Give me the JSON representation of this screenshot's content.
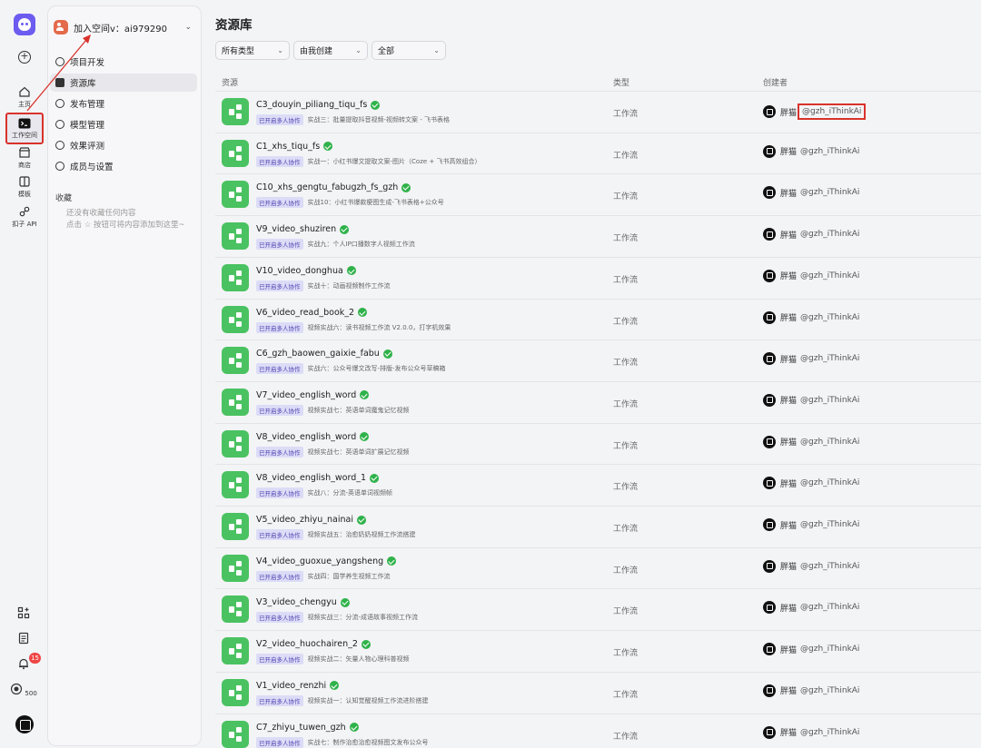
{
  "rail": {
    "items": [
      {
        "label": "主页",
        "icon": "home-icon"
      },
      {
        "label": "工作空间",
        "icon": "terminal-icon"
      },
      {
        "label": "商店",
        "icon": "store-icon"
      },
      {
        "label": "模板",
        "icon": "template-icon"
      },
      {
        "label": "扣子 API",
        "icon": "api-icon"
      }
    ],
    "notification_count": "15",
    "points": "500"
  },
  "sidebar": {
    "space_name": "加入空间v：ai979290",
    "nav": [
      {
        "label": "项目开发",
        "icon": "smile-icon"
      },
      {
        "label": "资源库",
        "icon": "library-icon"
      },
      {
        "label": "发布管理",
        "icon": "rocket-icon"
      },
      {
        "label": "模型管理",
        "icon": "cube-icon"
      },
      {
        "label": "效果评测",
        "icon": "gauge-icon"
      },
      {
        "label": "成员与设置",
        "icon": "users-icon"
      }
    ],
    "favorites_title": "收藏",
    "favorites_empty_1": "还没有收藏任何内容",
    "favorites_empty_2": "点击 ☆ 按钮可将内容添加到这里~"
  },
  "main": {
    "title": "资源库",
    "filters": [
      "所有类型",
      "由我创建",
      "全部"
    ],
    "columns": [
      "资源",
      "类型",
      "创建者"
    ],
    "tag": "已开启多人协作",
    "rows": [
      {
        "name": "C3_douyin_piliang_tiqu_fs",
        "desc": "实战三：批量提取抖音视频-视频转文案 - 飞书表格",
        "type": "工作流",
        "creator": "胖猫",
        "handle": "@gzh_iThinkAi"
      },
      {
        "name": "C1_xhs_tiqu_fs",
        "desc": "实战一：小红书爆文提取文案-图片（Coze + 飞书高效组合）",
        "type": "工作流",
        "creator": "胖猫",
        "handle": "@gzh_iThinkAi"
      },
      {
        "name": "C10_xhs_gengtu_fabugzh_fs_gzh",
        "desc": "实战10：小红书爆款梗图生成-飞书表格+公众号",
        "type": "工作流",
        "creator": "胖猫",
        "handle": "@gzh_iThinkAi"
      },
      {
        "name": "V9_video_shuziren",
        "desc": "实战九：个人IP口播数字人视频工作流",
        "type": "工作流",
        "creator": "胖猫",
        "handle": "@gzh_iThinkAi"
      },
      {
        "name": "V10_video_donghua",
        "desc": "实战十：动画视频制作工作流",
        "type": "工作流",
        "creator": "胖猫",
        "handle": "@gzh_iThinkAi"
      },
      {
        "name": "V6_video_read_book_2",
        "desc": "视频实战六：读书视频工作流 V2.0.0，打字机效果",
        "type": "工作流",
        "creator": "胖猫",
        "handle": "@gzh_iThinkAi"
      },
      {
        "name": "C6_gzh_baowen_gaixie_fabu",
        "desc": "实战六：公众号爆文改写-排版-发布公众号草稿箱",
        "type": "工作流",
        "creator": "胖猫",
        "handle": "@gzh_iThinkAi"
      },
      {
        "name": "V7_video_english_word",
        "desc": "视频实战七：英语单词魔鬼记忆视频",
        "type": "工作流",
        "creator": "胖猫",
        "handle": "@gzh_iThinkAi"
      },
      {
        "name": "V8_video_english_word",
        "desc": "视频实战七：英语单词扩展记忆视频",
        "type": "工作流",
        "creator": "胖猫",
        "handle": "@gzh_iThinkAi"
      },
      {
        "name": "V8_video_english_word_1",
        "desc": "实战八：分流-英语单词视频帧",
        "type": "工作流",
        "creator": "胖猫",
        "handle": "@gzh_iThinkAi"
      },
      {
        "name": "V5_video_zhiyu_nainai",
        "desc": "视频实战五：治愈奶奶视频工作流搭建",
        "type": "工作流",
        "creator": "胖猫",
        "handle": "@gzh_iThinkAi"
      },
      {
        "name": "V4_video_guoxue_yangsheng",
        "desc": "实战四：国学养生视频工作流",
        "type": "工作流",
        "creator": "胖猫",
        "handle": "@gzh_iThinkAi"
      },
      {
        "name": "V3_video_chengyu",
        "desc": "视频实战三：分流-成语故事视频工作流",
        "type": "工作流",
        "creator": "胖猫",
        "handle": "@gzh_iThinkAi"
      },
      {
        "name": "V2_video_huochairen_2",
        "desc": "视频实战二：矢量人物心理科普视频",
        "type": "工作流",
        "creator": "胖猫",
        "handle": "@gzh_iThinkAi"
      },
      {
        "name": "V1_video_renzhi",
        "desc": "视频实战一：认知觉醒视频工作流进阶搭建",
        "type": "工作流",
        "creator": "胖猫",
        "handle": "@gzh_iThinkAi"
      },
      {
        "name": "C7_zhiyu_tuwen_gzh",
        "desc": "实战七：制作治愈治愈视频图文发布公众号",
        "type": "工作流",
        "creator": "胖猫",
        "handle": "@gzh_iThinkAi"
      }
    ]
  },
  "colors": {
    "accent": "#6d5cf0",
    "workflow_icon": "#4ac261",
    "highlight": "#d9322c"
  }
}
